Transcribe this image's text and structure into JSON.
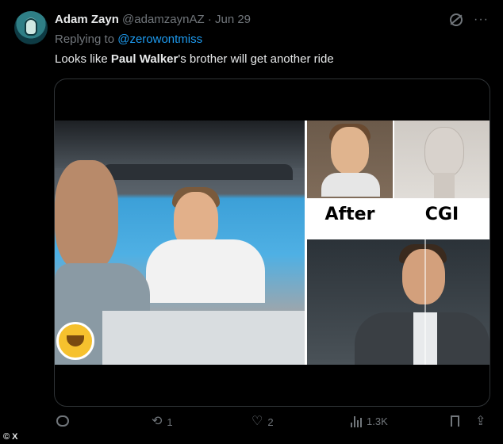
{
  "author": {
    "name": "Adam Zayn",
    "handle": "@adamzaynAZ",
    "separator": "·",
    "date": "Jun 29"
  },
  "reply": {
    "prefix": "Replying to",
    "to": "@zerowontmiss"
  },
  "tweet": {
    "before": "Looks like ",
    "bold": "Paul Walker",
    "after": "'s brother will get another ride"
  },
  "top_icons": {
    "grok": "grok-icon",
    "more": "···"
  },
  "media": {
    "labels": {
      "after": "After",
      "cgi": "CGI"
    }
  },
  "actions": {
    "reply": {
      "icon": "reply-icon",
      "count": ""
    },
    "retweet": {
      "icon": "retweet-icon",
      "symbol": "⟲",
      "count": "1"
    },
    "like": {
      "icon": "heart-icon",
      "symbol": "♡",
      "count": "2"
    },
    "views": {
      "icon": "views-icon",
      "count": "1.3K"
    },
    "bookmark": {
      "icon": "bookmark-icon"
    },
    "share": {
      "icon": "share-icon",
      "symbol": "⇪"
    }
  },
  "footer": {
    "logo": "© X"
  },
  "colors": {
    "accent": "#1d9bf0",
    "muted": "#71767b",
    "text": "#e7e9ea",
    "background": "#000000"
  }
}
